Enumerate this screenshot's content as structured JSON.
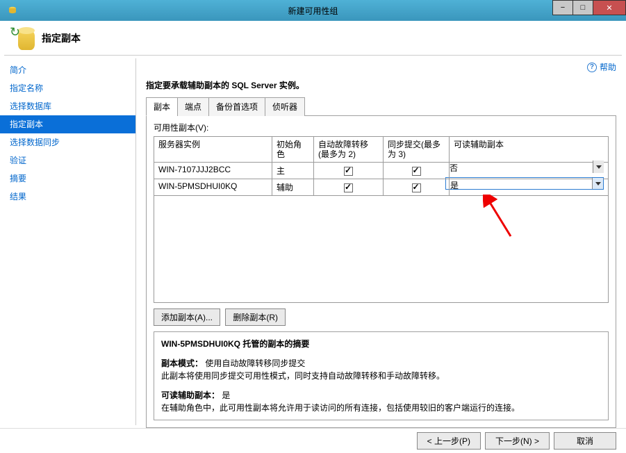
{
  "window": {
    "title": "新建可用性组"
  },
  "header": {
    "heading": "指定副本"
  },
  "sidebar": {
    "items": [
      {
        "label": "简介",
        "selected": false
      },
      {
        "label": "指定名称",
        "selected": false
      },
      {
        "label": "选择数据库",
        "selected": false
      },
      {
        "label": "指定副本",
        "selected": true
      },
      {
        "label": "选择数据同步",
        "selected": false
      },
      {
        "label": "验证",
        "selected": false
      },
      {
        "label": "摘要",
        "selected": false
      },
      {
        "label": "结果",
        "selected": false
      }
    ]
  },
  "main": {
    "help_label": "帮助",
    "instruction": "指定要承载辅助副本的 SQL Server 实例。",
    "tabs": [
      {
        "label": "副本",
        "active": true
      },
      {
        "label": "端点",
        "active": false
      },
      {
        "label": "备份首选项",
        "active": false
      },
      {
        "label": "侦听器",
        "active": false
      }
    ],
    "grid": {
      "caption": "可用性副本(V):",
      "columns": [
        "服务器实例",
        "初始角色",
        "自动故障转移(最多为 2)",
        "同步提交(最多为 3)",
        "可读辅助副本"
      ],
      "rows": [
        {
          "server": "WIN-7107JJJ2BCC",
          "role": "主",
          "auto_failover": true,
          "sync_commit": true,
          "readable": "否",
          "highlight": false
        },
        {
          "server": "WIN-5PMSDHUI0KQ",
          "role": "辅助",
          "auto_failover": true,
          "sync_commit": true,
          "readable": "是",
          "highlight": true
        }
      ]
    },
    "buttons": {
      "add_replica": "添加副本(A)...",
      "remove_replica": "删除副本(R)"
    },
    "summary": {
      "title": "WIN-5PMSDHUI0KQ 托管的副本的摘要",
      "mode_label": "副本模式：",
      "mode_value": "使用自动故障转移同步提交",
      "mode_desc": "此副本将使用同步提交可用性模式，同时支持自动故障转移和手动故障转移。",
      "readable_label": "可读辅助副本：",
      "readable_value": "是",
      "readable_desc": "在辅助角色中，此可用性副本将允许用于读访问的所有连接，包括使用较旧的客户端运行的连接。"
    }
  },
  "footer": {
    "prev": "<  上一步(P)",
    "next": "下一步(N)  >",
    "cancel": "取消"
  }
}
